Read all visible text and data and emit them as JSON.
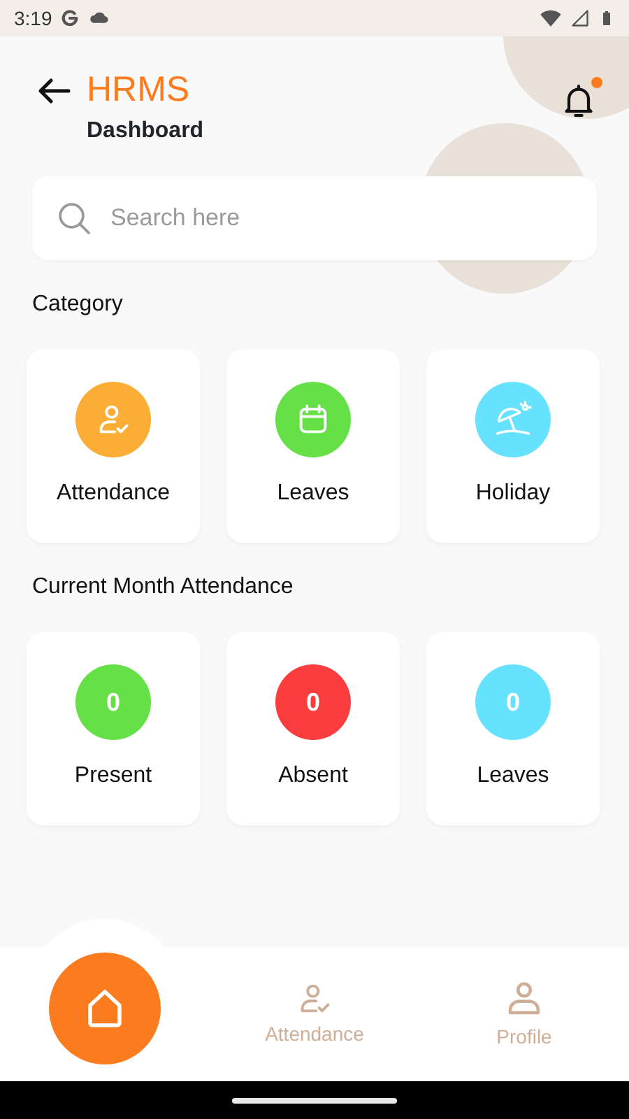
{
  "status_bar": {
    "time": "3:19"
  },
  "header": {
    "title": "HRMS",
    "subtitle": "Dashboard",
    "notifications_unread": true
  },
  "search": {
    "placeholder": "Search here"
  },
  "category": {
    "title": "Category",
    "items": [
      {
        "label": "Attendance",
        "kind": "attendance",
        "color": "#fbad35"
      },
      {
        "label": "Leaves",
        "kind": "calendar",
        "color": "#66e047"
      },
      {
        "label": "Holiday",
        "kind": "holiday",
        "color": "#66e2fe"
      }
    ]
  },
  "month_attendance": {
    "title": "Current Month Attendance",
    "items": [
      {
        "value": "0",
        "label": "Present",
        "color": "#66e047"
      },
      {
        "value": "0",
        "label": "Absent",
        "color": "#fb3d3d"
      },
      {
        "value": "0",
        "label": "Leaves",
        "color": "#66e2fe"
      }
    ]
  },
  "bottom_nav": [
    {
      "kind": "home",
      "selected": true
    },
    {
      "kind": "attendance",
      "label": "Attendance",
      "selected": false
    },
    {
      "kind": "profile",
      "label": "Profile",
      "selected": false
    }
  ]
}
